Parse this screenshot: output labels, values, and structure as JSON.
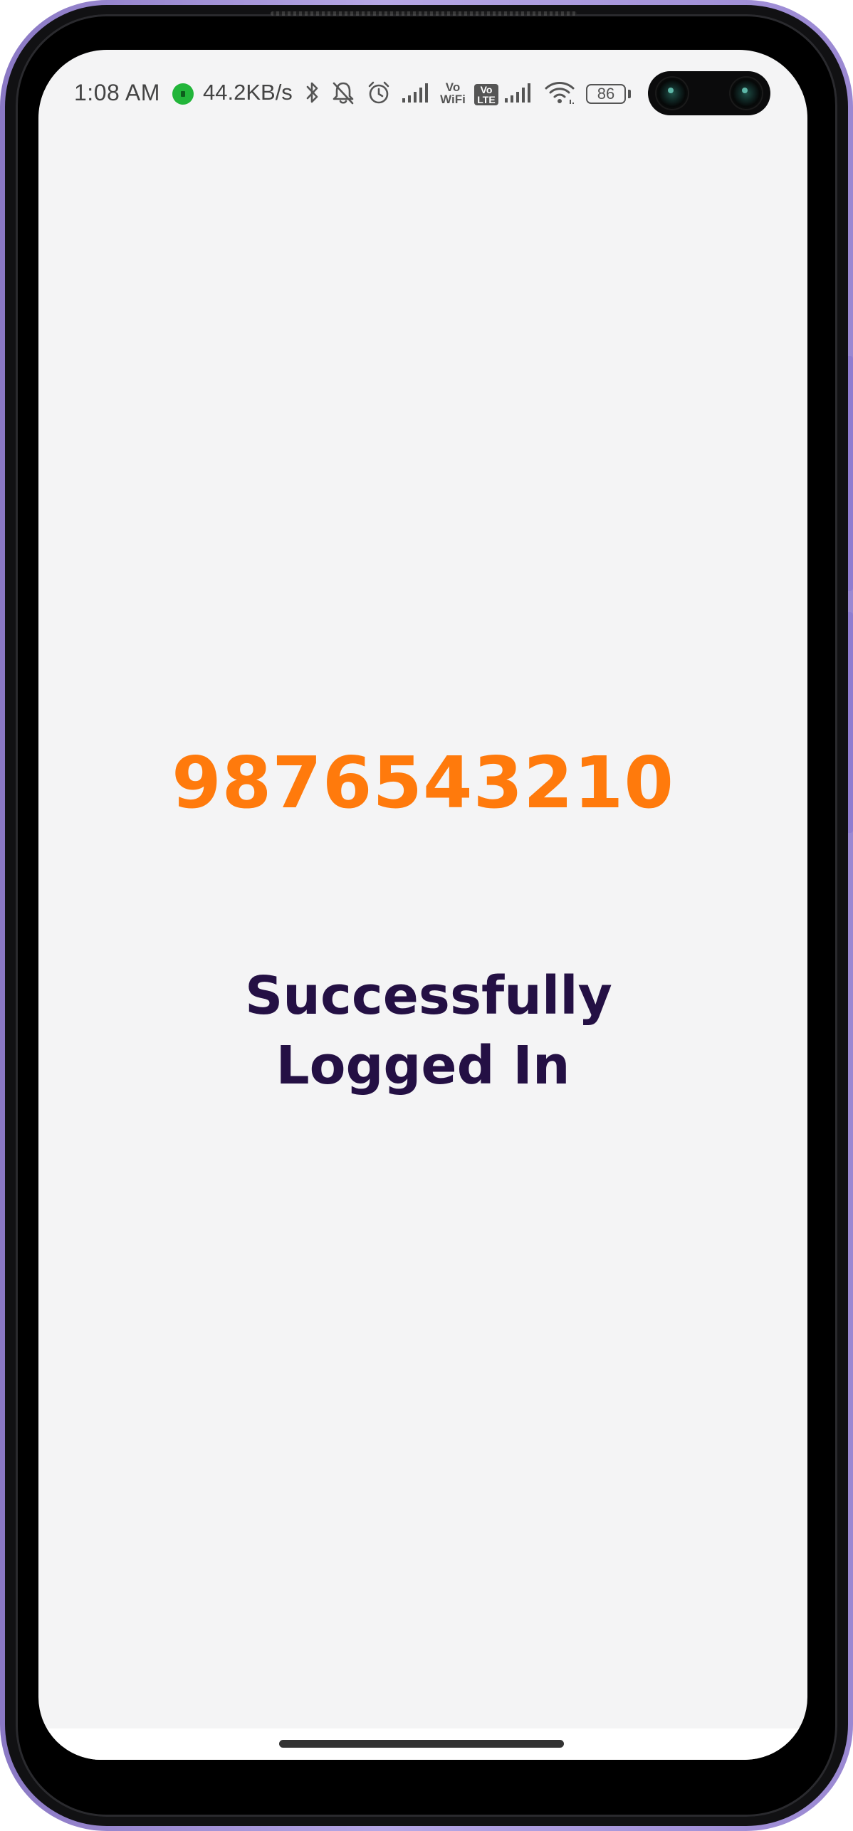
{
  "status_bar": {
    "time": "1:08 AM",
    "network_speed": "44.2KB/s",
    "vowifi_label_top": "Vo",
    "vowifi_label_bottom": "WiFi",
    "volte_label_top": "Vo",
    "volte_label_bottom": "LTE",
    "battery_level": "86",
    "icons": [
      "network-activity-icon",
      "bluetooth-icon",
      "notifications-off-icon",
      "alarm-icon",
      "signal-icon",
      "vowifi-icon",
      "volte-icon",
      "signal-icon",
      "wifi-icon",
      "battery-icon"
    ]
  },
  "main": {
    "phone_number": "9876543210",
    "success_message": "Successfully Logged In"
  },
  "colors": {
    "phone_number": "#ff7a0c",
    "success_message": "#241044",
    "background": "#f4f4f5",
    "frame_accent": "#9a88d2",
    "network_indicator": "#22b53a"
  }
}
